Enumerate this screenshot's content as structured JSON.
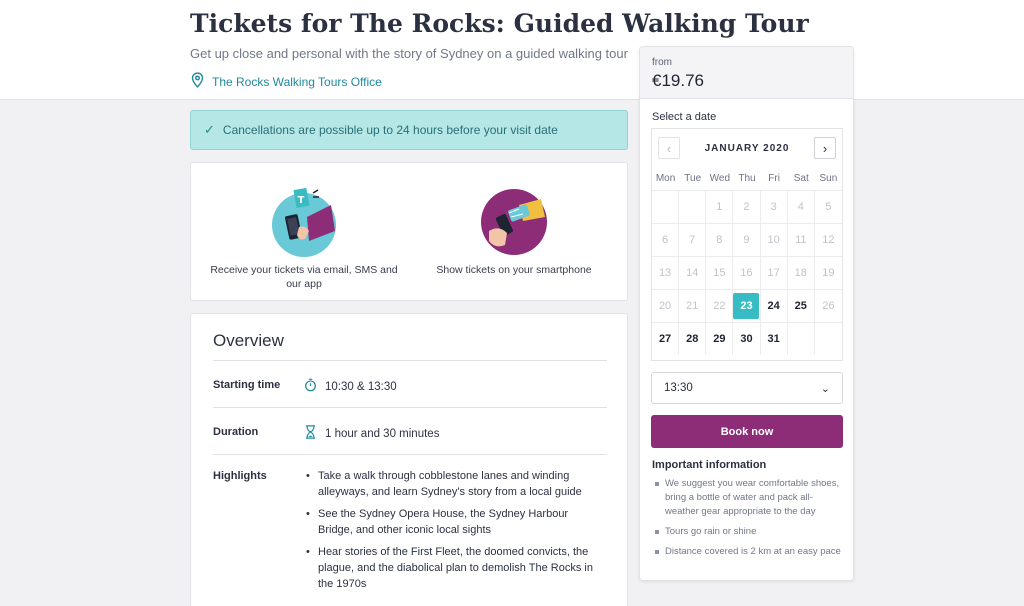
{
  "header": {
    "title": "Tickets for The Rocks: Guided Walking Tour",
    "subtitle": "Get up close and personal with the story of Sydney on a guided walking tour",
    "location": "The Rocks Walking Tours Office",
    "location_icon": "map-pin-icon"
  },
  "cancellation": {
    "text": "Cancellations are possible up to 24 hours before your visit date"
  },
  "delivery": {
    "items": [
      {
        "label": "Receive your tickets via email, SMS and our app",
        "icon": "phone-ticket-illustration"
      },
      {
        "label": "Show tickets on your smartphone",
        "icon": "smartphone-scan-illustration"
      }
    ]
  },
  "overview": {
    "title": "Overview",
    "starting_time_label": "Starting time",
    "starting_time_value": "10:30 & 13:30",
    "duration_label": "Duration",
    "duration_value": "1 hour and 30 minutes",
    "highlights_label": "Highlights",
    "highlights": [
      "Take a walk through cobblestone lanes and winding alleyways, and learn Sydney's story from a local guide",
      "See the Sydney Opera House, the Sydney Harbour Bridge, and other iconic local sights",
      "Hear stories of the First Fleet, the doomed convicts, the plague, and the diabolical plan to demolish The Rocks in the 1970s"
    ]
  },
  "booking": {
    "from_label": "from",
    "price": "€19.76",
    "select_date_label": "Select a date",
    "calendar": {
      "month": "JANUARY 2020",
      "prev": "‹",
      "next": "›",
      "weekdays": [
        "Mon",
        "Tue",
        "Wed",
        "Thu",
        "Fri",
        "Sat",
        "Sun"
      ],
      "days": [
        {
          "d": "",
          "s": "empty"
        },
        {
          "d": "",
          "s": "empty"
        },
        {
          "d": "1",
          "s": "disabled"
        },
        {
          "d": "2",
          "s": "disabled"
        },
        {
          "d": "3",
          "s": "disabled"
        },
        {
          "d": "4",
          "s": "disabled"
        },
        {
          "d": "5",
          "s": "disabled"
        },
        {
          "d": "6",
          "s": "disabled"
        },
        {
          "d": "7",
          "s": "disabled"
        },
        {
          "d": "8",
          "s": "disabled"
        },
        {
          "d": "9",
          "s": "disabled"
        },
        {
          "d": "10",
          "s": "disabled"
        },
        {
          "d": "11",
          "s": "disabled"
        },
        {
          "d": "12",
          "s": "disabled"
        },
        {
          "d": "13",
          "s": "disabled"
        },
        {
          "d": "14",
          "s": "disabled"
        },
        {
          "d": "15",
          "s": "disabled"
        },
        {
          "d": "16",
          "s": "disabled"
        },
        {
          "d": "17",
          "s": "disabled"
        },
        {
          "d": "18",
          "s": "disabled"
        },
        {
          "d": "19",
          "s": "disabled"
        },
        {
          "d": "20",
          "s": "disabled"
        },
        {
          "d": "21",
          "s": "disabled"
        },
        {
          "d": "22",
          "s": "disabled"
        },
        {
          "d": "23",
          "s": "selected"
        },
        {
          "d": "24",
          "s": "available"
        },
        {
          "d": "25",
          "s": "available"
        },
        {
          "d": "26",
          "s": "disabled"
        },
        {
          "d": "27",
          "s": "available"
        },
        {
          "d": "28",
          "s": "available"
        },
        {
          "d": "29",
          "s": "available"
        },
        {
          "d": "30",
          "s": "available"
        },
        {
          "d": "31",
          "s": "available"
        },
        {
          "d": "",
          "s": "empty"
        },
        {
          "d": "",
          "s": "empty"
        }
      ]
    },
    "time_selected": "13:30",
    "book_button": "Book now",
    "important_title": "Important information",
    "important_items": [
      "We suggest you wear comfortable shoes, bring a bottle of water and pack all-weather gear appropriate to the day",
      "Tours go rain or shine",
      "Distance covered is 2 km at an easy pace"
    ]
  },
  "colors": {
    "accent_teal": "#38bcc3",
    "brand_purple": "#8e2d77",
    "notice_bg": "#b4e7e6",
    "link_teal": "#1f8a9c"
  }
}
